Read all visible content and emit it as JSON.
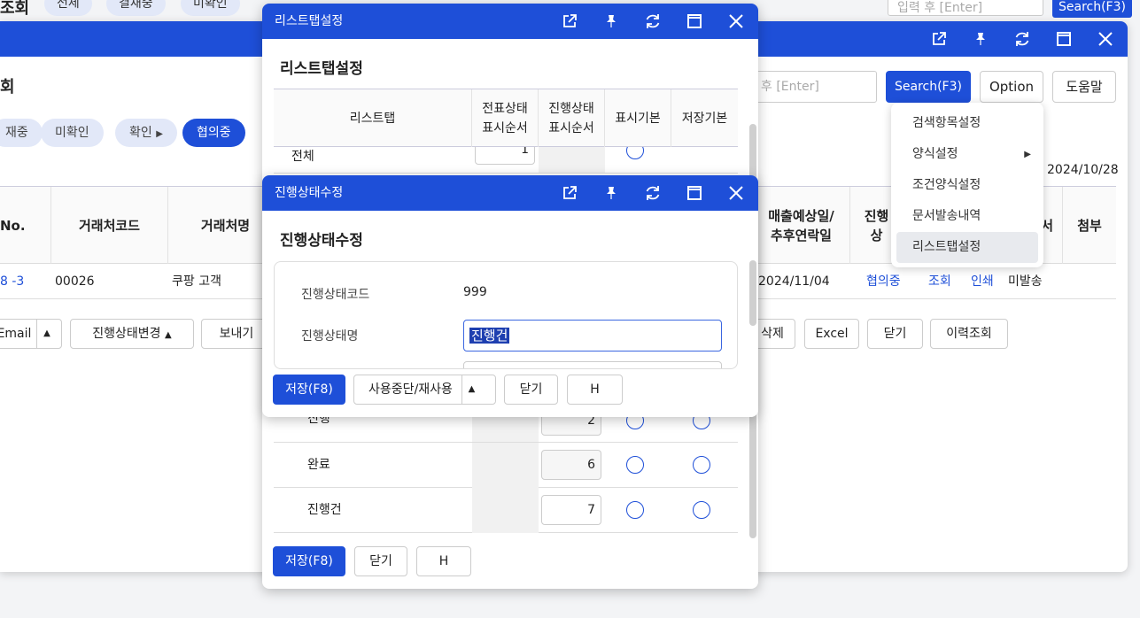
{
  "bg_top": {
    "title": "조회",
    "pills": [
      "전체",
      "결재중",
      "미확인",
      "확인",
      "협의중",
      "진행",
      "완료",
      "진행건"
    ],
    "search_placeholder": "입력 후 [Enter]",
    "search_label": "Search(F3)"
  },
  "main": {
    "title": "회",
    "tabs": [
      "재중",
      "미확인",
      "확인",
      "협의중"
    ],
    "search_placeholder": "후 [Enter]",
    "search_label": "Search(F3)",
    "option_label": "Option",
    "help_label": "도움말",
    "date": "2024/10/28",
    "columns": [
      "No.",
      "거래처코드",
      "거래처명",
      "매출예상일/\n추후연락일",
      "진행상",
      "서",
      "첨부"
    ],
    "row": {
      "no": "8 -3",
      "code": "00026",
      "name": "쿠팡 고객",
      "date": "2024/11/04",
      "status": "협의중",
      "view": "조회",
      "print": "인쇄",
      "send": "미발송"
    },
    "actions": {
      "email": "Email",
      "status_change": "진행상태변경",
      "send": "보내기",
      "delete": "삭제",
      "excel": "Excel",
      "close": "닫기",
      "history": "이력조회"
    }
  },
  "dropdown": {
    "items": [
      "검색항목설정",
      "양식설정",
      "조건양식설정",
      "문서발송내역",
      "리스트탭설정"
    ]
  },
  "listtab_dialog": {
    "header": "리스트탭설정",
    "title": "리스트탭설정",
    "columns": [
      "리스트탭",
      "전표상태\n표시순서",
      "진행상태\n표시순서",
      "표시기본",
      "저장기본"
    ],
    "rows": [
      {
        "name": "전체",
        "order": "1"
      },
      {
        "name": "진행",
        "order": "2"
      },
      {
        "name": "완료",
        "order": "6"
      },
      {
        "name": "진행건",
        "order": "7"
      }
    ],
    "save_label": "저장(F8)",
    "close_label": "닫기",
    "h_label": "H"
  },
  "status_dialog": {
    "header": "진행상태수정",
    "title": "진행상태수정",
    "code_label": "진행상태코드",
    "code_value": "999",
    "name_label": "진행상태명",
    "name_value": "진행건",
    "save_label": "저장(F8)",
    "toggle_label": "사용중단/재사용",
    "close_label": "닫기",
    "h_label": "H"
  },
  "colors": {
    "primary": "#1e4fd8",
    "pill_bg": "#e2e8f8",
    "radio": "#1e4fd8"
  }
}
